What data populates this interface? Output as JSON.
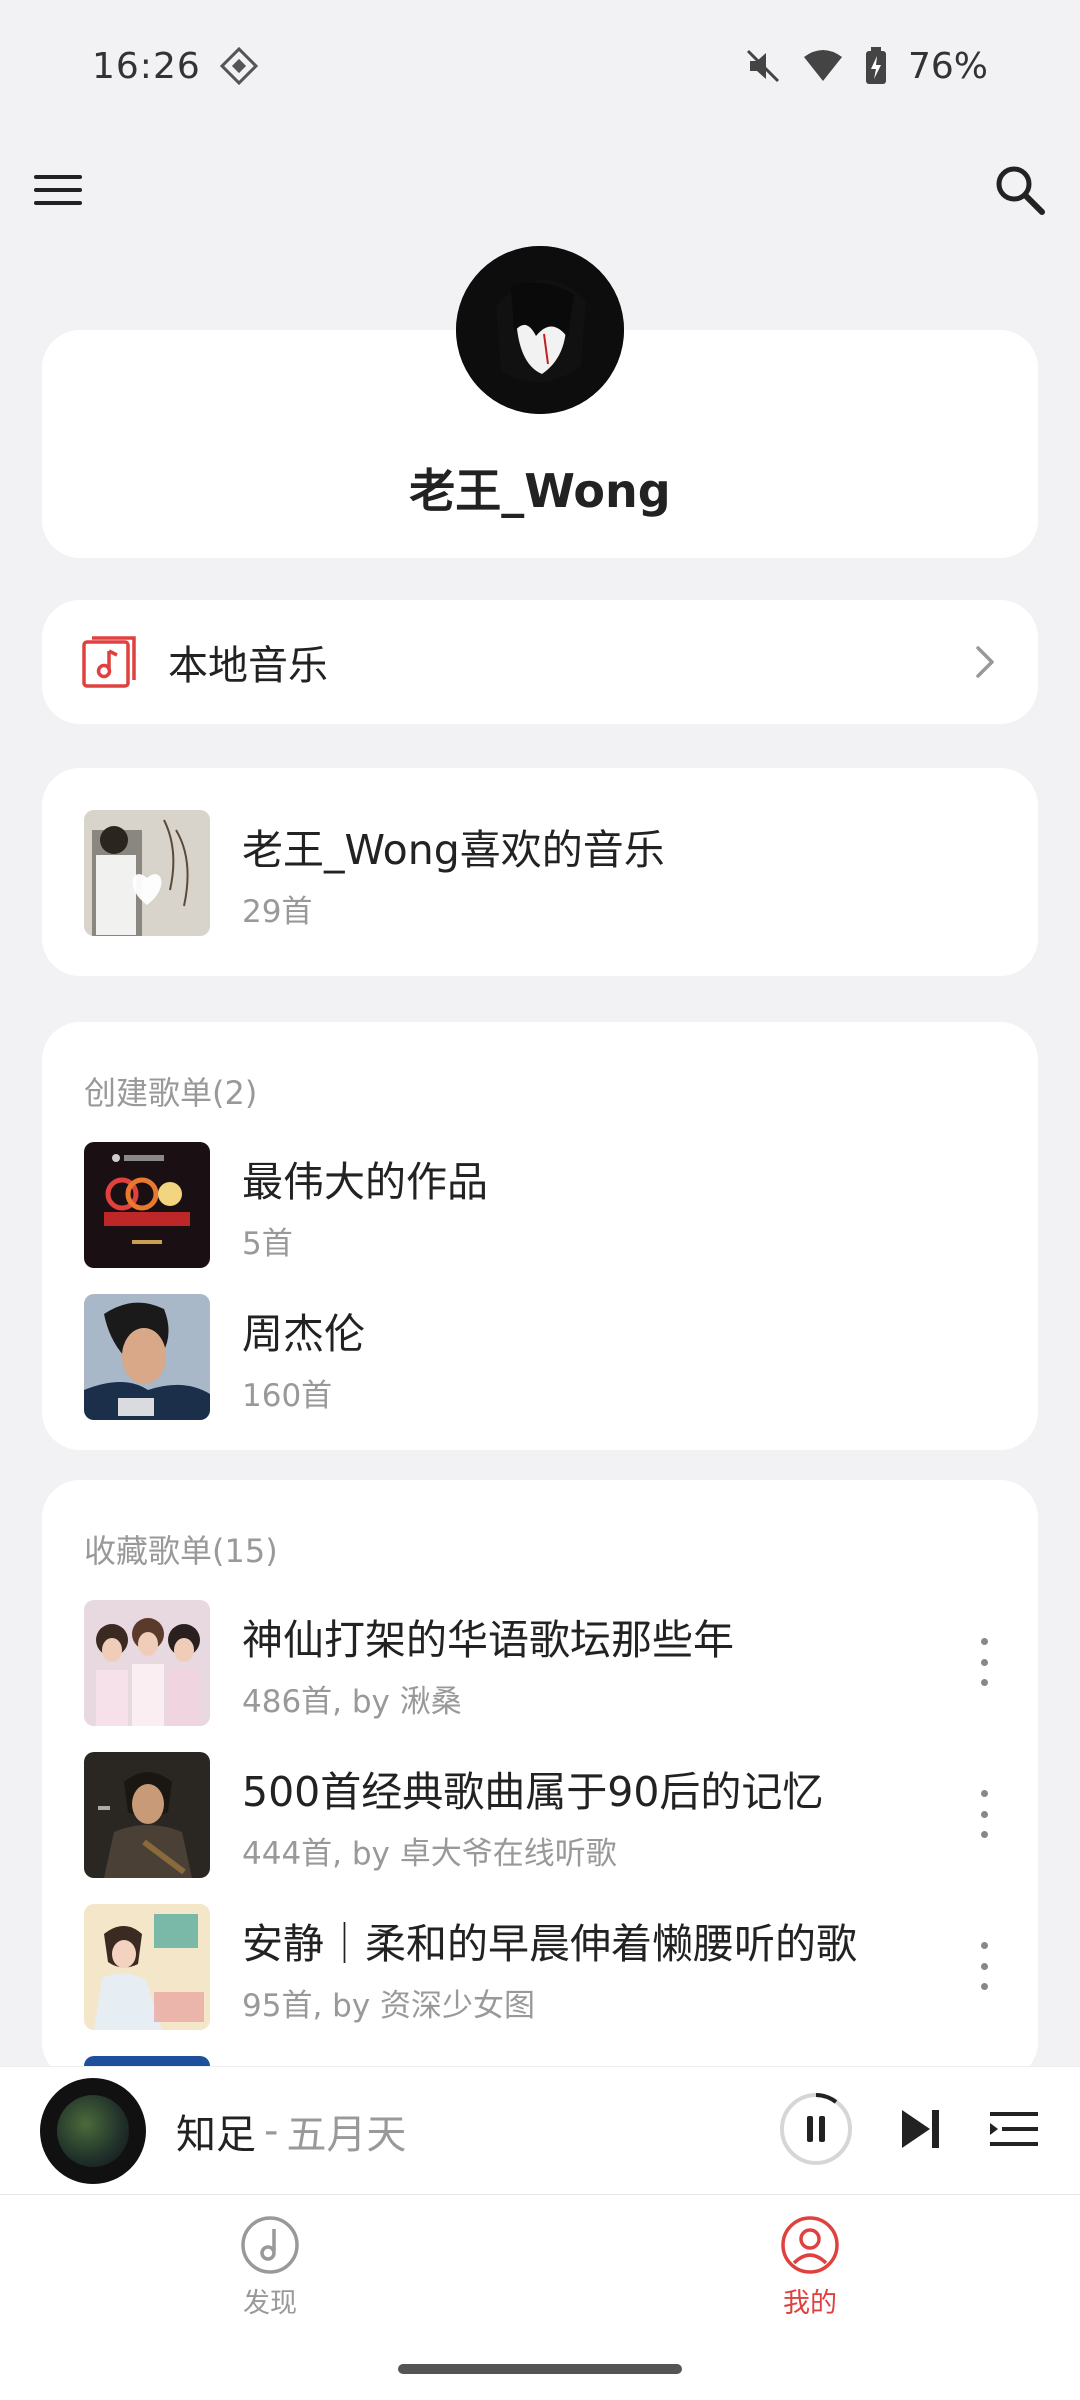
{
  "status_bar": {
    "time": "16:26",
    "battery": "76%"
  },
  "profile": {
    "username": "老王_Wong"
  },
  "local_music": {
    "label": "本地音乐"
  },
  "liked": {
    "title": "老王_Wong喜欢的音乐",
    "count": "29首"
  },
  "created_playlists": {
    "header": "创建歌单(2)",
    "items": [
      {
        "title": "最伟大的作品",
        "count": "5首"
      },
      {
        "title": "周杰伦",
        "count": "160首"
      }
    ]
  },
  "collected_playlists": {
    "header": "收藏歌单(15)",
    "items": [
      {
        "title": "神仙打架的华语歌坛那些年",
        "subtitle": "486首, by 湫桑"
      },
      {
        "title": "500首经典歌曲属于90后的记忆",
        "subtitle": "444首, by 卓大爷在线听歌"
      },
      {
        "title": "安静｜柔和的早晨伸着懒腰听的歌",
        "subtitle": "95首, by 资深少女图"
      }
    ]
  },
  "player": {
    "song": "知足",
    "separator": "-",
    "artist": "五月天"
  },
  "tabs": {
    "discover": "发现",
    "mine": "我的"
  },
  "colors": {
    "accent": "#e0413f",
    "muted": "#999999"
  }
}
